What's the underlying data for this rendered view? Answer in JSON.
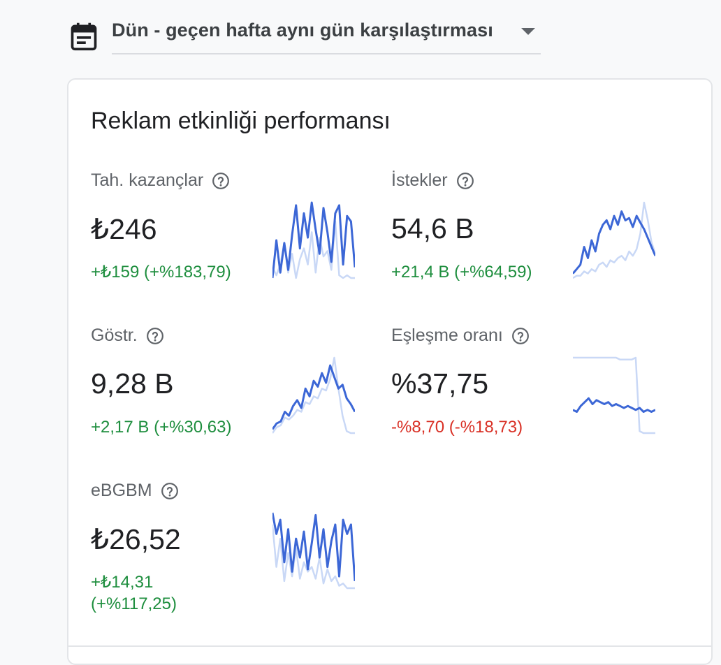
{
  "date_range": {
    "label": "Dün - geçen hafta aynı gün karşılaştırması"
  },
  "card": {
    "title": "Reklam etkinliği performansı"
  },
  "colors": {
    "current_series": "#3c67d6",
    "previous_series": "#c9d8f6",
    "positive": "#1e8e3e",
    "negative": "#d93025"
  },
  "metrics": [
    {
      "label": "Tah. kazançlar",
      "value": "₺246",
      "change": "+₺159 (+%183,79)",
      "trend": "positive",
      "spark_current": [
        1,
        15,
        3,
        14,
        4,
        17,
        28,
        12,
        25,
        16,
        29,
        19,
        10,
        27,
        18,
        7,
        25,
        28,
        6,
        24,
        22,
        5
      ],
      "spark_previous": [
        5,
        2,
        6,
        14,
        3,
        10,
        1,
        8,
        12,
        6,
        18,
        3,
        16,
        9,
        11,
        4,
        22,
        2,
        1,
        2,
        1,
        1
      ]
    },
    {
      "label": "İstekler",
      "value": "54,6 B",
      "change": "+21,4 B (+%64,59)",
      "trend": "positive",
      "spark_current": [
        4,
        6,
        8,
        16,
        11,
        19,
        14,
        22,
        26,
        28,
        24,
        30,
        26,
        32,
        28,
        29,
        25,
        30,
        27,
        24,
        20,
        16,
        12
      ],
      "spark_previous": [
        2,
        3,
        3,
        5,
        4,
        6,
        5,
        8,
        9,
        7,
        10,
        9,
        11,
        12,
        10,
        14,
        12,
        15,
        22,
        36,
        28,
        18,
        13
      ]
    },
    {
      "label": "Göstr.",
      "value": "9,28 B",
      "change": "+2,17 B (+%30,63)",
      "trend": "positive",
      "spark_current": [
        3,
        6,
        7,
        12,
        10,
        15,
        18,
        14,
        24,
        20,
        28,
        25,
        32,
        27,
        36,
        30,
        24,
        26,
        19,
        16,
        12
      ],
      "spark_previous": [
        1,
        4,
        5,
        9,
        8,
        10,
        13,
        12,
        17,
        16,
        20,
        19,
        24,
        23,
        29,
        40,
        24,
        10,
        2,
        1,
        1
      ]
    },
    {
      "label": "Eşleşme oranı",
      "value": "%37,75",
      "change": "-%8,70 (-%18,73)",
      "trend": "negative",
      "spark_current": [
        13,
        12,
        15,
        17,
        19,
        16,
        18,
        17,
        16,
        17,
        15,
        16,
        15,
        14,
        15,
        14,
        13,
        14,
        12,
        13,
        12,
        13
      ],
      "spark_previous": [
        40,
        40,
        40,
        40,
        40,
        40,
        40,
        40,
        40,
        40,
        40,
        40,
        39,
        39,
        39,
        39,
        40,
        2,
        1,
        1,
        1,
        1
      ]
    },
    {
      "label": "eBGBM",
      "value": "₺26,52",
      "change": "+₺14,31 (+%117,25)",
      "trend": "positive",
      "spark_current": [
        33,
        24,
        30,
        12,
        26,
        8,
        22,
        14,
        25,
        9,
        20,
        32,
        14,
        26,
        10,
        21,
        28,
        6,
        30,
        24,
        28,
        4
      ],
      "spark_previous": [
        28,
        10,
        22,
        4,
        16,
        6,
        18,
        5,
        12,
        8,
        10,
        5,
        14,
        3,
        9,
        4,
        6,
        2,
        3,
        1,
        1,
        1
      ]
    }
  ]
}
